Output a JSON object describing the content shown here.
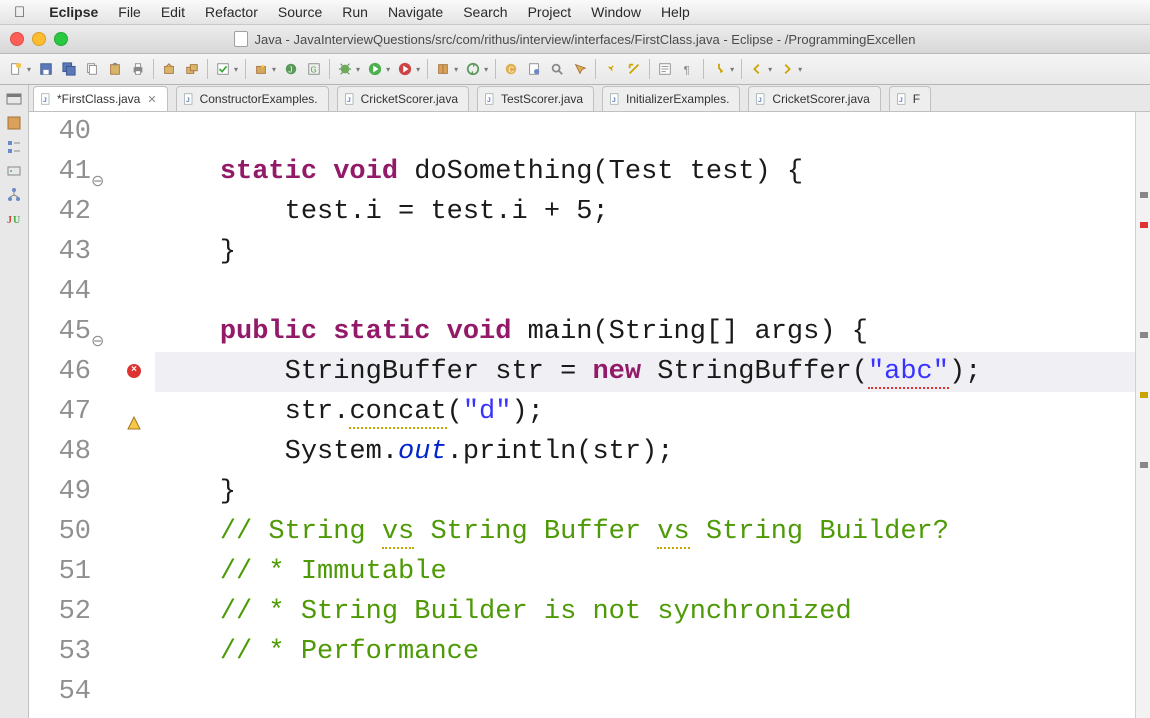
{
  "mac_menu": {
    "app": "Eclipse",
    "items": [
      "File",
      "Edit",
      "Refactor",
      "Source",
      "Run",
      "Navigate",
      "Search",
      "Project",
      "Window",
      "Help"
    ]
  },
  "window_title": "Java - JavaInterviewQuestions/src/com/rithus/interview/interfaces/FirstClass.java - Eclipse - /ProgrammingExcellen",
  "editor_tabs": [
    {
      "label": "*FirstClass.java",
      "active": true,
      "closable": true
    },
    {
      "label": "ConstructorExamples.",
      "active": false,
      "closable": false
    },
    {
      "label": "CricketScorer.java",
      "active": false,
      "closable": false
    },
    {
      "label": "TestScorer.java",
      "active": false,
      "closable": false
    },
    {
      "label": "InitializerExamples.",
      "active": false,
      "closable": false
    },
    {
      "label": "CricketScorer.java",
      "active": false,
      "closable": false
    },
    {
      "label": "F",
      "active": false,
      "closable": false
    }
  ],
  "code": {
    "first_line_no": 40,
    "lines": [
      {
        "n": 40,
        "t": "plain",
        "text": ""
      },
      {
        "n": 41,
        "t": "sig1",
        "fold": true
      },
      {
        "n": 42,
        "t": "body1"
      },
      {
        "n": 43,
        "t": "close"
      },
      {
        "n": 44,
        "t": "plain",
        "text": ""
      },
      {
        "n": 45,
        "t": "sig2",
        "fold": true
      },
      {
        "n": 46,
        "t": "buf",
        "hl": true,
        "err": true
      },
      {
        "n": 47,
        "t": "concat",
        "warn": true
      },
      {
        "n": 48,
        "t": "println"
      },
      {
        "n": 49,
        "t": "close"
      },
      {
        "n": 50,
        "t": "c1"
      },
      {
        "n": 51,
        "t": "c2"
      },
      {
        "n": 52,
        "t": "c3"
      },
      {
        "n": 53,
        "t": "c4"
      },
      {
        "n": 54,
        "t": "plain",
        "text": ""
      }
    ],
    "tokens": {
      "static": "static",
      "void": "void",
      "public": "public",
      "new": "new",
      "doSomething": "doSomething",
      "Test": "Test",
      "test": "test",
      "main": "main",
      "String": "String",
      "args": "args",
      "StringBuffer": "StringBuffer",
      "str": "str",
      "abc": "\"abc\"",
      "concat": "concat",
      "d": "\"d\"",
      "System": "System",
      "out": "out",
      "println": "println",
      "i": "i",
      "c1": "// String vs String Buffer vs String Builder?",
      "vs1": "vs",
      "vs2": "vs",
      "c2": "// * Immutable",
      "c3": "// * String Builder is not synchronized",
      "c4": "// * Performance"
    }
  },
  "toolbar_icons": [
    "new",
    "save",
    "save-all",
    "copy",
    "paste",
    "print",
    "sep",
    "build",
    "build-all",
    "sep",
    "check",
    "sep",
    "wizard",
    "type",
    "junit",
    "sep",
    "debug",
    "run",
    "run-ext",
    "sep",
    "package",
    "sync",
    "sep",
    "open-type",
    "open-task",
    "search",
    "task",
    "sep",
    "pin",
    "select",
    "sep",
    "paragraph",
    "pilcrow",
    "sep",
    "step",
    "sep",
    "back",
    "fwd"
  ],
  "toolbar_dropdown_after": [
    "new",
    "check",
    "wizard",
    "debug",
    "run",
    "run-ext",
    "package",
    "sync",
    "step",
    "back",
    "fwd"
  ]
}
